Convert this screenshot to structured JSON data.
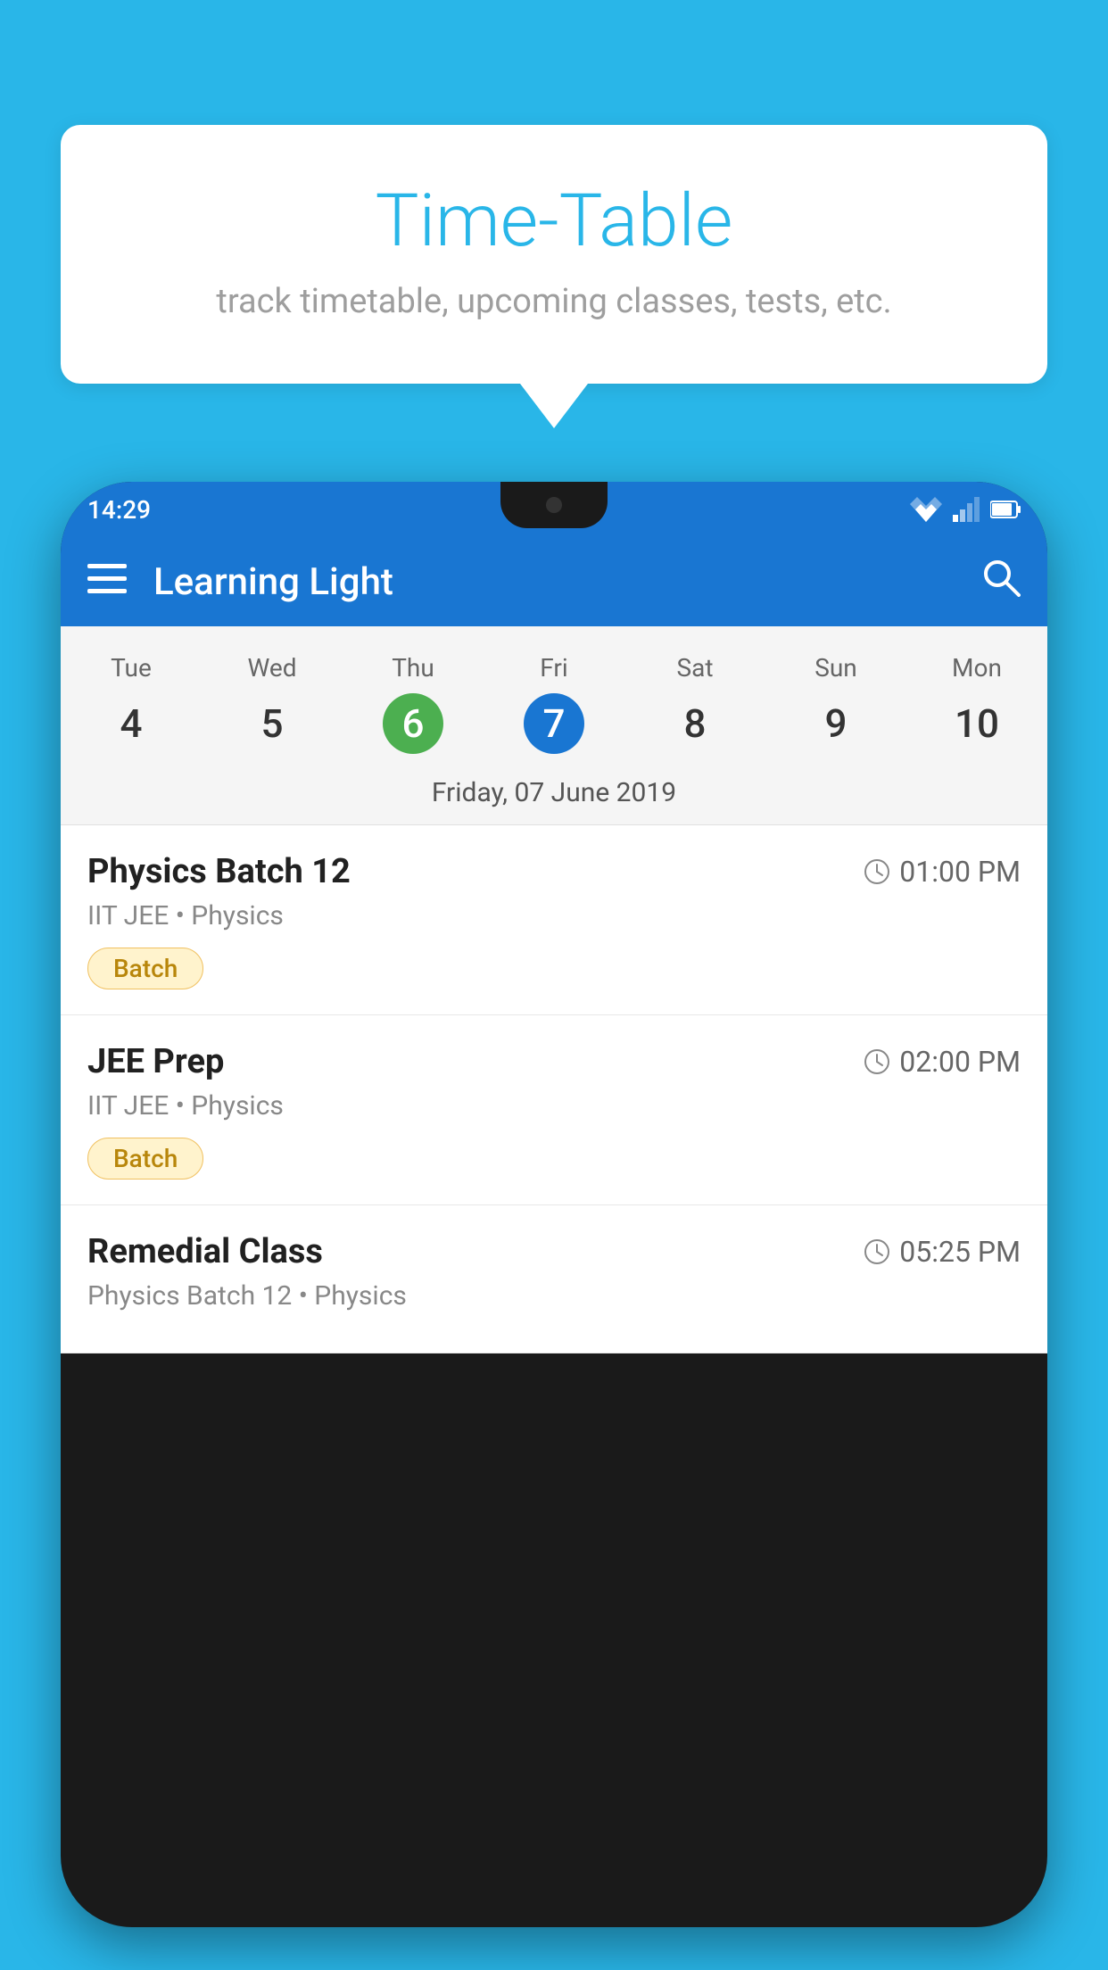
{
  "background_color": "#29b6e8",
  "speech_bubble": {
    "title": "Time-Table",
    "subtitle": "track timetable, upcoming classes, tests, etc."
  },
  "phone": {
    "status_bar": {
      "time": "14:29"
    },
    "app_bar": {
      "title": "Learning Light"
    },
    "calendar": {
      "days": [
        {
          "label": "Tue",
          "number": "4",
          "state": "normal"
        },
        {
          "label": "Wed",
          "number": "5",
          "state": "normal"
        },
        {
          "label": "Thu",
          "number": "6",
          "state": "today"
        },
        {
          "label": "Fri",
          "number": "7",
          "state": "selected"
        },
        {
          "label": "Sat",
          "number": "8",
          "state": "normal"
        },
        {
          "label": "Sun",
          "number": "9",
          "state": "normal"
        },
        {
          "label": "Mon",
          "number": "10",
          "state": "normal"
        }
      ],
      "selected_date_label": "Friday, 07 June 2019"
    },
    "schedule": [
      {
        "title": "Physics Batch 12",
        "time": "01:00 PM",
        "subtitle": "IIT JEE • Physics",
        "tag": "Batch"
      },
      {
        "title": "JEE Prep",
        "time": "02:00 PM",
        "subtitle": "IIT JEE • Physics",
        "tag": "Batch"
      },
      {
        "title": "Remedial Class",
        "time": "05:25 PM",
        "subtitle": "Physics Batch 12 • Physics",
        "tag": null
      }
    ]
  }
}
